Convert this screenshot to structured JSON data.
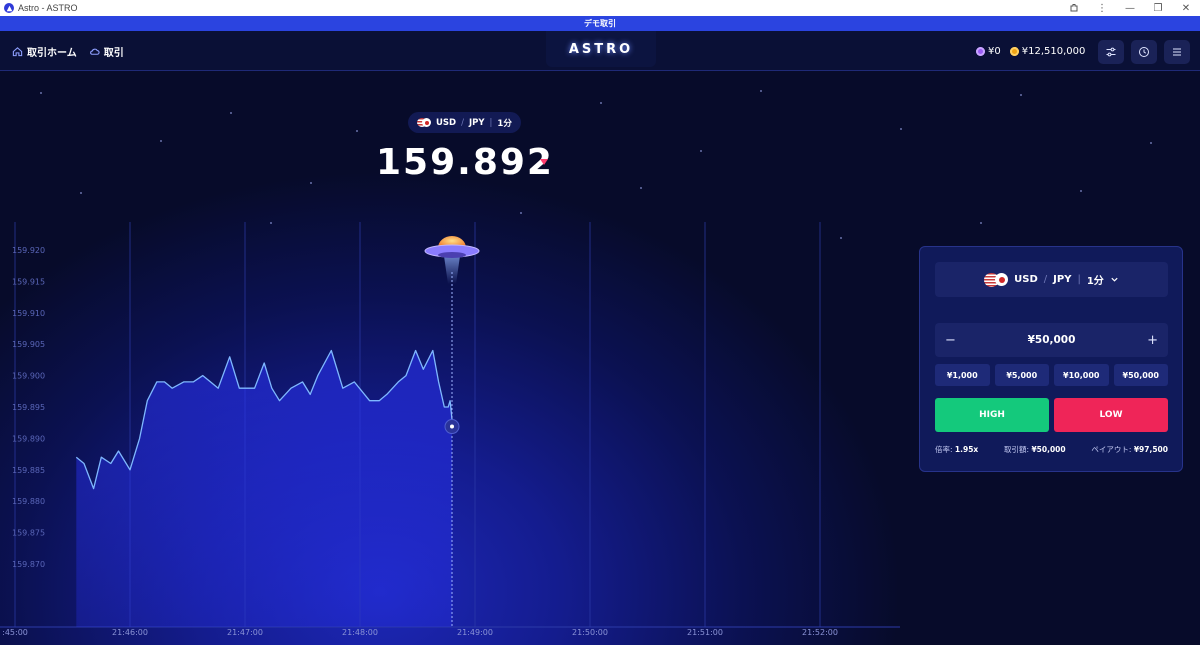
{
  "window": {
    "title": "Astro - ASTRO"
  },
  "banner": {
    "text": "デモ取引"
  },
  "header": {
    "nav": [
      {
        "label": "取引ホーム",
        "icon": "home-icon"
      },
      {
        "label": "取引",
        "icon": "cloud-icon"
      }
    ],
    "logo": "ASTRO",
    "balances": {
      "bonus": "¥0",
      "cash": "¥12,510,000"
    },
    "buttons": [
      "settings-sliders-icon",
      "history-clock-icon",
      "menu-icon"
    ]
  },
  "quote": {
    "pair": "USD",
    "quote": "JPY",
    "timeframe": "1分",
    "price": "159.892",
    "direction": "down"
  },
  "chart_data": {
    "type": "line",
    "title": "",
    "xlabel": "",
    "ylabel": "",
    "yticks": [
      "159.920",
      "159.915",
      "159.910",
      "159.905",
      "159.900",
      "159.895",
      "159.890",
      "159.885",
      "159.880",
      "159.875",
      "159.870"
    ],
    "xticks": [
      ":45:00",
      "21:46:00",
      "21:47:00",
      "21:48:00",
      "21:49:00",
      "21:50:00",
      "21:51:00",
      "21:52:00"
    ],
    "ylim": [
      159.866,
      159.922
    ],
    "series": [
      {
        "x": [
          "21:45:32",
          "21:45:36",
          "21:45:41",
          "21:45:45",
          "21:45:50",
          "21:45:54",
          "21:46:00",
          "21:46:05",
          "21:46:09",
          "21:46:14",
          "21:46:18",
          "21:46:22",
          "21:46:28",
          "21:46:33",
          "21:46:38",
          "21:46:46",
          "21:46:52",
          "21:46:57",
          "21:47:05",
          "21:47:10",
          "21:47:14",
          "21:47:18",
          "21:47:24",
          "21:47:30",
          "21:47:34",
          "21:47:38",
          "21:47:45",
          "21:47:51",
          "21:47:57",
          "21:48:05",
          "21:48:10",
          "21:48:14",
          "21:48:20",
          "21:48:24",
          "21:48:29",
          "21:48:33",
          "21:48:38",
          "21:48:41",
          "21:48:44",
          "21:48:46",
          "21:48:47",
          "21:48:48"
        ],
        "values": [
          159.887,
          159.886,
          159.882,
          159.887,
          159.886,
          159.888,
          159.885,
          159.89,
          159.896,
          159.899,
          159.899,
          159.898,
          159.899,
          159.899,
          159.9,
          159.898,
          159.903,
          159.898,
          159.898,
          159.902,
          159.898,
          159.896,
          159.898,
          159.899,
          159.897,
          159.9,
          159.904,
          159.898,
          159.899,
          159.896,
          159.896,
          159.897,
          159.899,
          159.9,
          159.904,
          159.901,
          159.904,
          159.899,
          159.895,
          159.895,
          159.896,
          159.893
        ]
      }
    ],
    "grid": true
  },
  "panel": {
    "pair": "USD",
    "quote": "JPY",
    "timeframe": "1分",
    "amount": "¥50,000",
    "minus": "−",
    "plus": "+",
    "presets": [
      "¥1,000",
      "¥5,000",
      "¥10,000",
      "¥50,000"
    ],
    "high_label": "HIGH",
    "low_label": "LOW",
    "rate_label": "倍率:",
    "rate_value": "1.95x",
    "stake_label": "取引額:",
    "stake_value": "¥50,000",
    "payout_label": "ペイアウト:",
    "payout_value": "¥97,500",
    "colors": {
      "high": "#14c97c",
      "low": "#ef2558"
    }
  }
}
